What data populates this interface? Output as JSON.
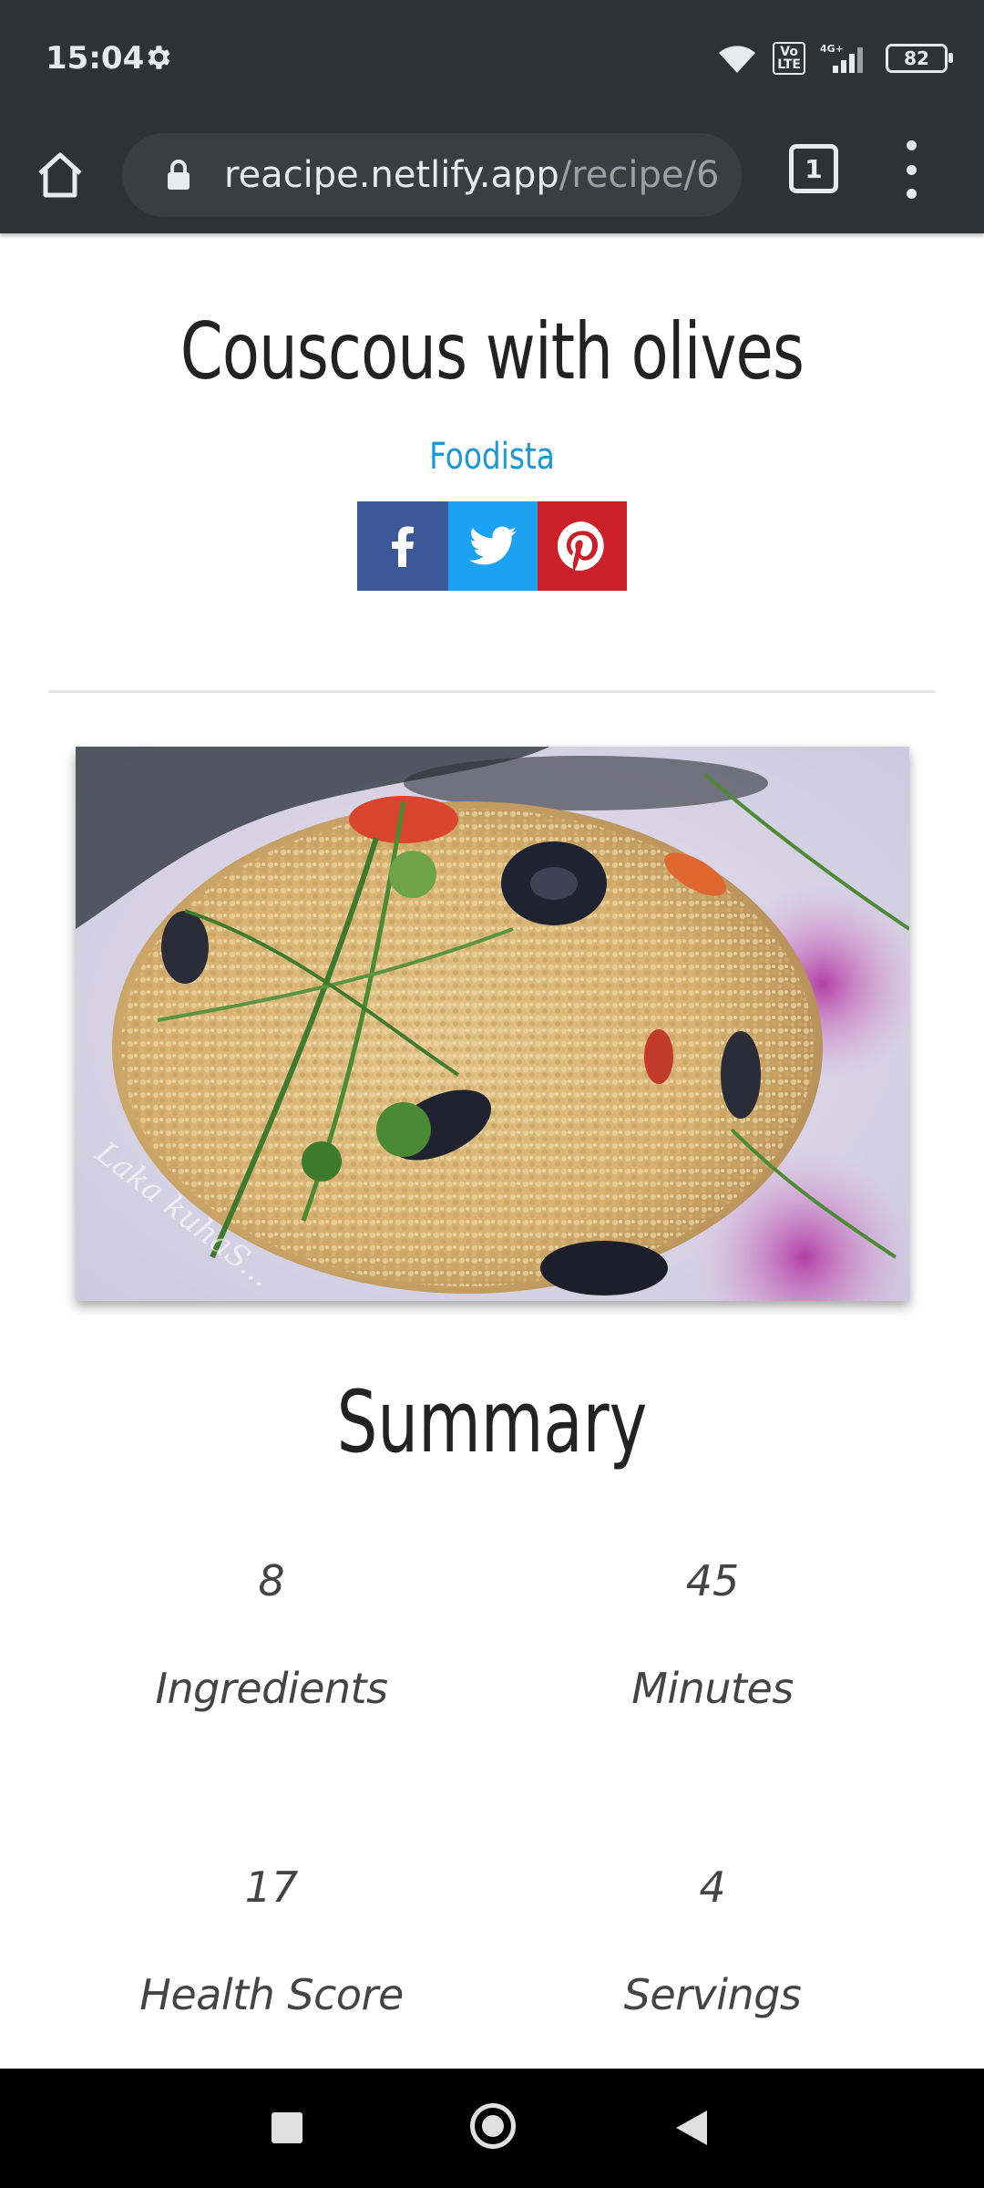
{
  "status_bar": {
    "time": "15:04",
    "network": "4G+",
    "volte": "Vo LTE",
    "battery": "82"
  },
  "browser": {
    "url_host": "reacipe.netlify.app",
    "url_path": "/recipe/6",
    "tab_count": "1"
  },
  "recipe": {
    "title": "Couscous with olives",
    "source": "Foodista",
    "share": [
      "facebook-icon",
      "twitter-icon",
      "pinterest-icon"
    ],
    "image_watermark": "Laka kuhaS..."
  },
  "summary": {
    "heading": "Summary",
    "stats": [
      {
        "value": "8",
        "label": "Ingredients"
      },
      {
        "value": "45",
        "label": "Minutes"
      },
      {
        "value": "17",
        "label": "Health Score"
      },
      {
        "value": "4",
        "label": "Servings"
      }
    ]
  },
  "colors": {
    "toolbar": "#303134",
    "source_link": "#1a99d6",
    "facebook": "#3b5998",
    "twitter": "#1da1f2",
    "pinterest": "#cb2027"
  }
}
